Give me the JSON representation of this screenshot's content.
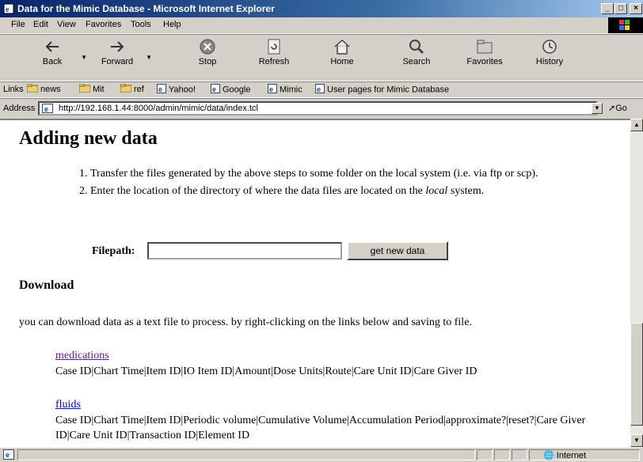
{
  "window": {
    "title": "Data for the Mimic Database - Microsoft Internet Explorer",
    "buttons": [
      "_",
      "□",
      "×"
    ]
  },
  "menu": [
    "File",
    "Edit",
    "View",
    "Favorites",
    "Tools",
    "Help"
  ],
  "toolbar": {
    "back": "Back",
    "forward": "Forward",
    "stop": "Stop",
    "refresh": "Refresh",
    "home": "Home",
    "search": "Search",
    "favorites": "Favorites",
    "history": "History"
  },
  "links": {
    "label": "Links",
    "items": [
      "news",
      "Mit",
      "ref",
      "Yahoo!",
      "Google",
      "Mimic",
      "User pages for Mimic Database"
    ]
  },
  "address": {
    "label": "Address",
    "url": "http://192.168.1.44:8000/admin/mimic/data/index.tcl",
    "go": "Go"
  },
  "page": {
    "heading": "Adding new data",
    "steps": [
      "Transfer the files generated by the above steps to some folder on the local system (i.e. via ftp or scp).",
      "Enter the location of the directory of where the data files are located on the ",
      "local",
      " system."
    ],
    "filepath_label": "Filepath:",
    "filepath_value": "",
    "get_button": "get new data",
    "download_heading": "Download",
    "download_intro": "you can download data as a text file to process. by right-clicking on the links below and saving to file.",
    "datasets": [
      {
        "name": "medications",
        "fields": "Case ID|Chart Time|Item ID|IO Item ID|Amount|Dose Units|Route|Care Unit ID|Care Giver ID"
      },
      {
        "name": "fluids",
        "fields": "Case ID|Chart Time|Item ID|Periodic volume|Cumulative Volume|Accumulation Period|approximate?|reset?|Care Giver ID|Care Unit ID|Transaction ID|Element ID"
      }
    ]
  },
  "status": {
    "zone": "Internet"
  }
}
